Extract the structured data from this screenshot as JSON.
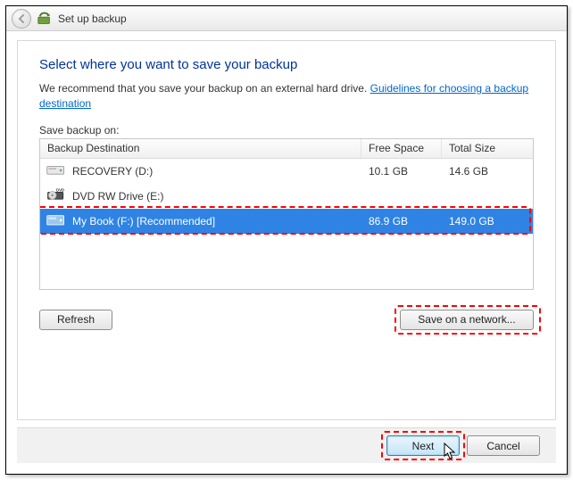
{
  "window": {
    "title": "Set up backup"
  },
  "main": {
    "heading": "Select where you want to save your backup",
    "subtext_a": "We recommend that you save your backup on an external hard drive. ",
    "guidelines_link": "Guidelines for choosing a backup destination",
    "save_on_label": "Save backup on:",
    "columns": {
      "dest": "Backup Destination",
      "free": "Free Space",
      "total": "Total Size"
    },
    "rows": [
      {
        "name": "RECOVERY (D:)",
        "free": "10.1 GB",
        "total": "14.6 GB",
        "icon": "hdd",
        "selected": false
      },
      {
        "name": "DVD RW Drive (E:)",
        "free": "",
        "total": "",
        "icon": "dvd",
        "selected": false
      },
      {
        "name": "My Book (F:) [Recommended]",
        "free": "86.9 GB",
        "total": "149.0 GB",
        "icon": "ext",
        "selected": true
      }
    ],
    "refresh_label": "Refresh",
    "network_label": "Save on a network..."
  },
  "footer": {
    "next_label": "Next",
    "cancel_label": "Cancel"
  }
}
